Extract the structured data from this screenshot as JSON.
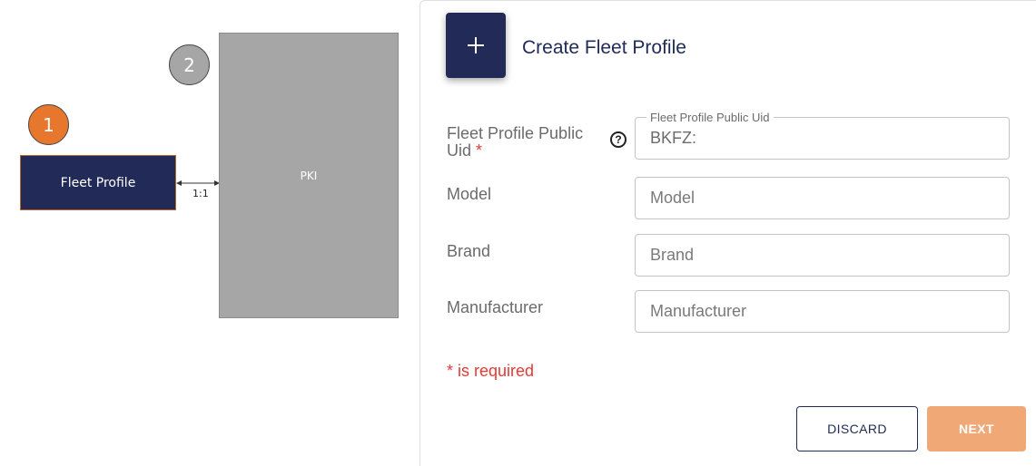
{
  "diagram": {
    "step1": "1",
    "step2": "2",
    "fleet_profile_box": "Fleet Profile",
    "pki_box": "PKI",
    "relation": "1:1"
  },
  "form": {
    "add_icon": "plus-icon",
    "title": "Create Fleet Profile",
    "fields": [
      {
        "label": "Fleet Profile Public Uid",
        "required_marker": "*",
        "floating_label": "Fleet Profile Public Uid",
        "value": "BKFZ:",
        "help_icon": "question-circle-icon"
      },
      {
        "label": "Model",
        "placeholder": "Model"
      },
      {
        "label": "Brand",
        "placeholder": "Brand"
      },
      {
        "label": "Manufacturer",
        "placeholder": "Manufacturer"
      }
    ],
    "required_note": "* is required",
    "discard_label": "DISCARD",
    "next_label": "NEXT"
  },
  "colors": {
    "navy": "#222b57",
    "orange": "#e8772e",
    "grey_box": "#a6a6a6",
    "next_disabled": "#f0a877",
    "required_red": "#e53935"
  }
}
